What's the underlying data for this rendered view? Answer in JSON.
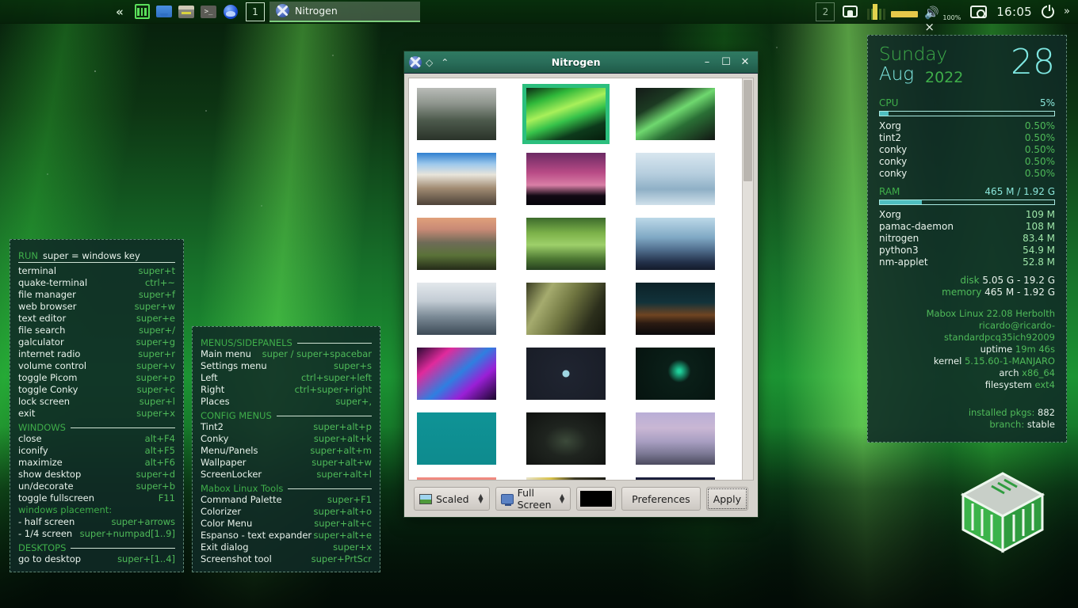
{
  "panel": {
    "launchers": [
      {
        "name": "collapse-chevron",
        "glyph": "«"
      },
      {
        "name": "mabox-menu-icon",
        "glyph": ""
      },
      {
        "name": "file-manager-icon",
        "glyph": ""
      },
      {
        "name": "archive-manager-icon",
        "glyph": ""
      },
      {
        "name": "terminal-icon",
        "glyph": ">_"
      },
      {
        "name": "web-browser-icon",
        "glyph": ""
      }
    ],
    "desktops": [
      {
        "label": "1",
        "active": true
      },
      {
        "label": "2",
        "active": false
      }
    ],
    "task": {
      "label": "Nitrogen"
    },
    "tray": {
      "volume_percent": "100%",
      "clock": "16:05",
      "overflow": "»"
    }
  },
  "conky_keys": {
    "title": "RUN",
    "title_right": "super = windows key",
    "run_items": [
      {
        "k": "terminal",
        "v": "super+t"
      },
      {
        "k": "quake-terminal",
        "v": "ctrl+~"
      },
      {
        "k": "file manager",
        "v": "super+f"
      },
      {
        "k": "web browser",
        "v": "super+w"
      },
      {
        "k": "text editor",
        "v": "super+e"
      },
      {
        "k": "file search",
        "v": "super+/"
      },
      {
        "k": "galculator",
        "v": "super+g"
      },
      {
        "k": "internet radio",
        "v": "super+r"
      },
      {
        "k": "volume control",
        "v": "super+v"
      },
      {
        "k": "toggle Picom",
        "v": "super+p"
      },
      {
        "k": "toggle Conky",
        "v": "super+c"
      },
      {
        "k": "lock screen",
        "v": "super+l"
      },
      {
        "k": "exit",
        "v": "super+x"
      }
    ],
    "windows_title": "WINDOWS",
    "windows_items": [
      {
        "k": "close",
        "v": "alt+F4"
      },
      {
        "k": "iconify",
        "v": "alt+F5"
      },
      {
        "k": "maximize",
        "v": "alt+F6"
      },
      {
        "k": "show desktop",
        "v": "super+d"
      },
      {
        "k": "un/decorate",
        "v": "super+b"
      },
      {
        "k": "toggle fullscreen",
        "v": "F11"
      }
    ],
    "placement_label": "windows placement:",
    "placement_items": [
      {
        "k": " - half screen",
        "v": "super+arrows"
      },
      {
        "k": " - 1/4 screen",
        "v": "super+numpad[1..9]"
      }
    ],
    "desktops_title": "DESKTOPS",
    "desktops_items": [
      {
        "k": "go to desktop",
        "v": "super+[1..4]"
      }
    ]
  },
  "conky_menus": {
    "menus_title": "MENUS/SIDEPANELS",
    "menus_items": [
      {
        "k": "Main menu",
        "v": "super / super+spacebar"
      },
      {
        "k": "Settings menu",
        "v": "super+s"
      },
      {
        "k": "Left",
        "v": "ctrl+super+left"
      },
      {
        "k": "Right",
        "v": "ctrl+super+right"
      },
      {
        "k": "Places",
        "v": "super+,"
      }
    ],
    "config_title": "CONFIG MENUS",
    "config_items": [
      {
        "k": "Tint2",
        "v": "super+alt+p"
      },
      {
        "k": "Conky",
        "v": "super+alt+k"
      },
      {
        "k": "Menu/Panels",
        "v": "super+alt+m"
      },
      {
        "k": "Wallpaper",
        "v": "super+alt+w"
      },
      {
        "k": "ScreenLocker",
        "v": "super+alt+l"
      }
    ],
    "tools_title": "Mabox Linux Tools",
    "tools_items": [
      {
        "k": "Command Palette",
        "v": "super+F1"
      },
      {
        "k": "Colorizer",
        "v": "super+alt+o"
      },
      {
        "k": "Color Menu",
        "v": "super+alt+c"
      },
      {
        "k": "Espanso - text expander",
        "v": "super+alt+e"
      },
      {
        "k": "Exit dialog",
        "v": "super+x"
      },
      {
        "k": "Screenshot tool",
        "v": "super+PrtScr"
      }
    ]
  },
  "conky_sys": {
    "day_of_week": "Sunday",
    "month": "Aug",
    "year": "2022",
    "day": "28",
    "cpu_label": "CPU",
    "cpu_value": "5%",
    "cpu_percent": 5,
    "cpu_processes": [
      {
        "n": "Xorg",
        "v": "0.50%"
      },
      {
        "n": "tint2",
        "v": "0.50%"
      },
      {
        "n": "conky",
        "v": "0.50%"
      },
      {
        "n": "conky",
        "v": "0.50%"
      },
      {
        "n": "conky",
        "v": "0.50%"
      }
    ],
    "ram_label": "RAM",
    "ram_value": "465 M / 1.92 G",
    "ram_percent": 24,
    "ram_processes": [
      {
        "n": "Xorg",
        "v": "109 M"
      },
      {
        "n": "pamac-daemon",
        "v": "108 M"
      },
      {
        "n": "nitrogen",
        "v": "83.4 M"
      },
      {
        "n": "python3",
        "v": "54.9 M"
      },
      {
        "n": "nm-applet",
        "v": "52.8 M"
      }
    ],
    "disk_label": "disk",
    "disk_value": "5.05 G - 19.2 G",
    "memory_label": "memory",
    "memory_value": "465 M - 1.92 G",
    "distro": "Mabox Linux 22.08 Herbolth",
    "userhost": "ricardo@ricardo-standardpcq35ich92009",
    "uptime_label": "uptime",
    "uptime_value": "19m 46s",
    "kernel_label": "kernel",
    "kernel_value": "5.15.60-1-MANJARO",
    "arch_label": "arch",
    "arch_value": "x86_64",
    "filesystem_label": "filesystem",
    "filesystem_value": "ext4",
    "pkgs_label": "installed pkgs:",
    "pkgs_value": "882",
    "branch_label": "branch:",
    "branch_value": "stable"
  },
  "nitrogen": {
    "title": "Nitrogen",
    "titlebar_buttons": {
      "menu": "◇",
      "shade": "⌃",
      "minimize": "–",
      "maximize": "☐",
      "close": "✕"
    },
    "scale_mode": "Scaled",
    "screen_mode": "Full Screen",
    "bg_color": "#000000",
    "preferences_label": "Preferences",
    "apply_label": "Apply",
    "selected_index": 1,
    "thumbnails": [
      {
        "name": "misty-forest-mountain",
        "css": "linear-gradient(to bottom, #b9bcb8 0%, #8e958d 30%, #4d5a4c 62%, #2a3329 100%)"
      },
      {
        "name": "aurora-borealis-green",
        "css": "linear-gradient(160deg, #0b2a14 0%, #2fb83a 22%, #a8f05a 42%, #36c24a 58%, #0d3a1b 78%, #061c0c 100%)"
      },
      {
        "name": "aurora-dark-green",
        "css": "linear-gradient(150deg, #141a18 0%, #1c3a22 28%, #6fd86f 48%, #2a6f35 66%, #121613 100%)"
      },
      {
        "name": "hot-air-balloons-valley",
        "css": "linear-gradient(to bottom, #2f7fd0 0%, #9fc9ec 22%, #e8e4da 42%, #a08b72 68%, #4d4238 100%)"
      },
      {
        "name": "pink-dusk-treeline",
        "css": "linear-gradient(to bottom, #6b2a63 0%, #b94b86 38%, #d97fa6 62%, #120a14 82%, #05030a 100%)"
      },
      {
        "name": "frozen-river-aerial",
        "css": "linear-gradient(to bottom, #d8e6ef 0%, #b6cede 40%, #8fb0c6 70%, #cfe0ea 100%)"
      },
      {
        "name": "sunset-mountain-valley",
        "css": "linear-gradient(to bottom, #e0a07a 0%, #c98a76 22%, #6e6b57 48%, #5a7238 72%, #232a18 100%)"
      },
      {
        "name": "green-rolling-hills",
        "css": "linear-gradient(to bottom, #3d6b2c 0%, #7db34a 30%, #9ed06a 52%, #4f7a34 78%, #26401f 100%)"
      },
      {
        "name": "blue-mountain-pines",
        "css": "linear-gradient(to bottom, #bcd9e8 0%, #7fa8c4 38%, #4f6d8c 62%, #23314a 85%, #131a2a 100%)"
      },
      {
        "name": "foggy-pine-forest",
        "css": "linear-gradient(to bottom, #e3e8ec 0%, #c3ccd4 35%, #7b8a96 65%, #3c4a56 100%)"
      },
      {
        "name": "grass-macro-dark",
        "css": "linear-gradient(120deg, #3a3d22 0%, #a5ab6e 25%, #6f7540 50%, #2c2f1c 78%, #15170d 100%)"
      },
      {
        "name": "mountain-sunrise-dark",
        "css": "linear-gradient(to bottom, #0c2228 0%, #12323a 38%, #6f4422 62%, #2a1a12 78%, #0a0a0c 100%)"
      },
      {
        "name": "retro-neon-computer",
        "css": "linear-gradient(140deg, #2a0a33 0%, #e02a9c 25%, #2f7fe0 52%, #9a1fd6 72%, #18062a 100%)"
      },
      {
        "name": "dark-minimal-moon",
        "css": "radial-gradient(circle at 50% 50%, #9fd6e2 0 7%, #1f2430 8%, #191d27 100%)"
      },
      {
        "name": "circuit-board-green",
        "css": "radial-gradient(circle at 55% 45%, #1fcf9a 0 3%, #0a1f18 22%, #06130f 100%)"
      },
      {
        "name": "teal-solid-color",
        "css": "linear-gradient(to bottom, #0f9396, #0e8b8e)"
      },
      {
        "name": "dark-3d-grid-plate",
        "css": "radial-gradient(ellipse at 50% 55%, #3c4a3a 0%, #1f241f 38%, #101210 100%)"
      },
      {
        "name": "purple-sea-rocks",
        "css": "linear-gradient(to bottom, #b9aed6 0%, #c9b7d4 30%, #a99fc2 55%, #7d7a96 78%, #4b4a5e 100%)"
      },
      {
        "name": "coral-pink-gradient",
        "css": "linear-gradient(to bottom, #f08a80, #e9736b)"
      },
      {
        "name": "yellow-dark-abstract",
        "css": "linear-gradient(100deg, #e8e3c8 0%, #d8c24a 28%, #3a3824 55%, #141410 100%)"
      },
      {
        "name": "navy-night-gradient",
        "css": "linear-gradient(to bottom, #1b1f3c, #14162c)"
      }
    ]
  }
}
